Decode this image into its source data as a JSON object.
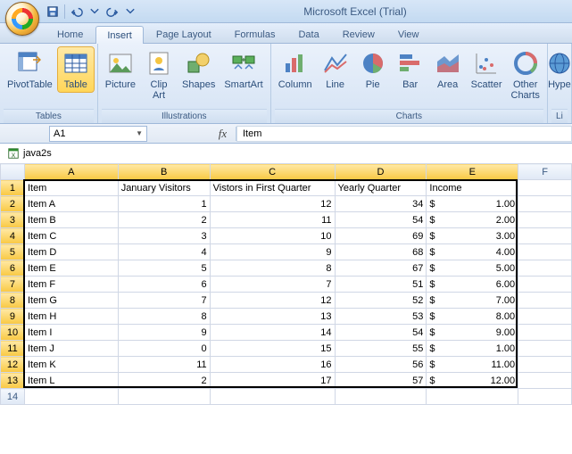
{
  "app": {
    "title": "Microsoft Excel (Trial)"
  },
  "qat": {
    "save": "Save",
    "undo": "Undo",
    "redo": "Redo"
  },
  "tabs": [
    "Home",
    "Insert",
    "Page Layout",
    "Formulas",
    "Data",
    "Review",
    "View"
  ],
  "active_tab": "Insert",
  "ribbon": {
    "groups": [
      {
        "label": "Tables",
        "buttons": [
          "PivotTable",
          "Table"
        ]
      },
      {
        "label": "Illustrations",
        "buttons": [
          "Picture",
          "Clip Art",
          "Shapes",
          "SmartArt"
        ]
      },
      {
        "label": "Charts",
        "buttons": [
          "Column",
          "Line",
          "Pie",
          "Bar",
          "Area",
          "Scatter",
          "Other Charts"
        ]
      },
      {
        "label": "Li",
        "buttons": [
          "Hype"
        ]
      }
    ]
  },
  "namebox": "A1",
  "formula": "Item",
  "workbook": "java2s",
  "columns": [
    "A",
    "B",
    "C",
    "D",
    "E",
    "F"
  ],
  "headers": [
    "Item",
    "January Visitors",
    "Vistors in First Quarter",
    "Yearly Quarter",
    "Income"
  ],
  "rows": [
    {
      "item": "Item A",
      "jan": 1,
      "q": 12,
      "y": 34,
      "inc": "1.00"
    },
    {
      "item": "Item B",
      "jan": 2,
      "q": 11,
      "y": 54,
      "inc": "2.00"
    },
    {
      "item": "Item C",
      "jan": 3,
      "q": 10,
      "y": 69,
      "inc": "3.00"
    },
    {
      "item": "Item D",
      "jan": 4,
      "q": 9,
      "y": 68,
      "inc": "4.00"
    },
    {
      "item": "Item E",
      "jan": 5,
      "q": 8,
      "y": 67,
      "inc": "5.00"
    },
    {
      "item": "Item F",
      "jan": 6,
      "q": 7,
      "y": 51,
      "inc": "6.00"
    },
    {
      "item": "Item G",
      "jan": 7,
      "q": 12,
      "y": 52,
      "inc": "7.00"
    },
    {
      "item": "Item H",
      "jan": 8,
      "q": 13,
      "y": 53,
      "inc": "8.00"
    },
    {
      "item": "Item I",
      "jan": 9,
      "q": 14,
      "y": 54,
      "inc": "9.00"
    },
    {
      "item": "Item J",
      "jan": 0,
      "q": 15,
      "y": 55,
      "inc": "1.00"
    },
    {
      "item": "Item K",
      "jan": 11,
      "q": 16,
      "y": 56,
      "inc": "11.00"
    },
    {
      "item": "Item L",
      "jan": 2,
      "q": 17,
      "y": 57,
      "inc": "12.00"
    }
  ],
  "currency": "$",
  "chart_data": {
    "type": "table",
    "title": "java2s",
    "columns": [
      "Item",
      "January Visitors",
      "Vistors in First Quarter",
      "Yearly Quarter",
      "Income"
    ],
    "data": [
      [
        "Item A",
        1,
        12,
        34,
        1.0
      ],
      [
        "Item B",
        2,
        11,
        54,
        2.0
      ],
      [
        "Item C",
        3,
        10,
        69,
        3.0
      ],
      [
        "Item D",
        4,
        9,
        68,
        4.0
      ],
      [
        "Item E",
        5,
        8,
        67,
        5.0
      ],
      [
        "Item F",
        6,
        7,
        51,
        6.0
      ],
      [
        "Item G",
        7,
        12,
        52,
        7.0
      ],
      [
        "Item H",
        8,
        13,
        53,
        8.0
      ],
      [
        "Item I",
        9,
        14,
        54,
        9.0
      ],
      [
        "Item J",
        0,
        15,
        55,
        1.0
      ],
      [
        "Item K",
        11,
        16,
        56,
        11.0
      ],
      [
        "Item L",
        2,
        17,
        57,
        12.0
      ]
    ]
  }
}
